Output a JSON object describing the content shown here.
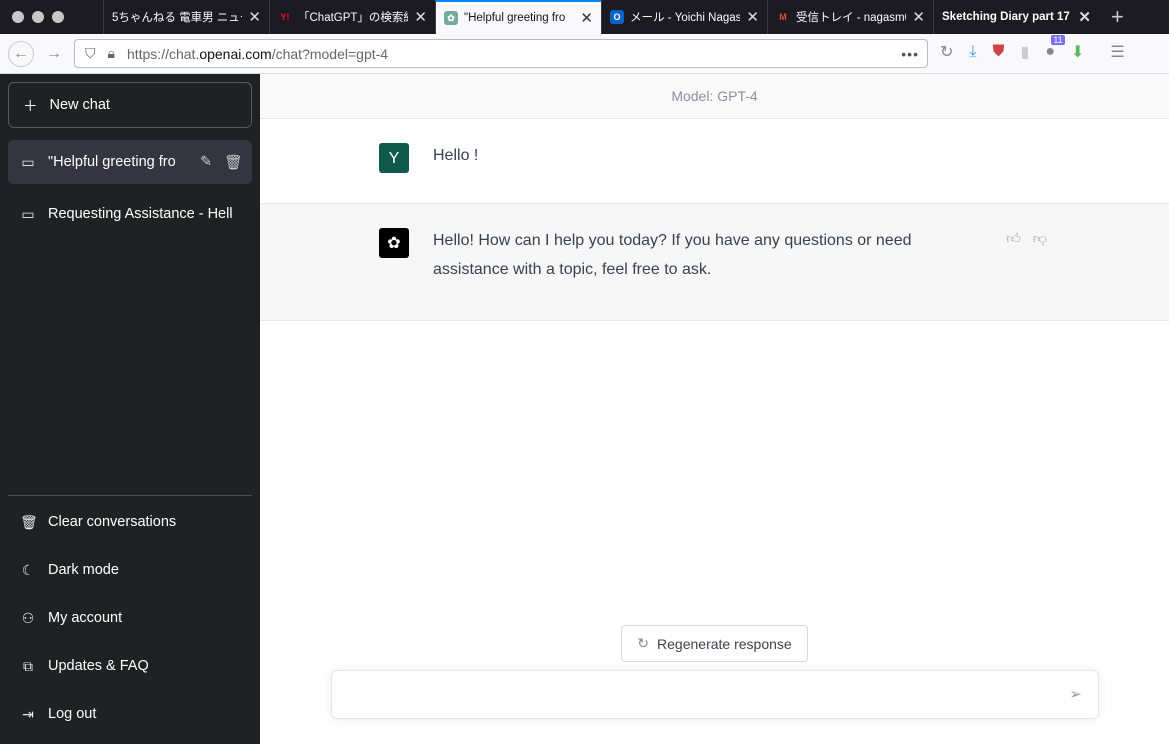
{
  "browser": {
    "tabs": [
      {
        "label": "5ちゃんねる 電車男 ニュー",
        "favicon": ""
      },
      {
        "label": "「ChatGPT」の検索結果",
        "favicon": "Y!"
      },
      {
        "label": "\"Helpful greeting fro",
        "favicon": "chatgpt",
        "active": true
      },
      {
        "label": "メール - Yoichi Nagas",
        "favicon": "O"
      },
      {
        "label": "受信トレイ - nagasm0",
        "favicon": "M"
      },
      {
        "label": "Sketching Diary part 17",
        "favicon": ""
      }
    ],
    "url_prefix": "https://chat.",
    "url_domain": "openai.com",
    "url_suffix": "/chat?model=gpt-4",
    "badge_count": "11"
  },
  "sidebar": {
    "new_chat": "New chat",
    "conversations": [
      "\"Helpful greeting fro",
      "Requesting Assistance - Hell"
    ],
    "items": [
      "Clear conversations",
      "Dark mode",
      "My account",
      "Updates & FAQ",
      "Log out"
    ]
  },
  "main": {
    "model_label": "Model: GPT-4",
    "user_initial": "Y",
    "user_message": "Hello !",
    "assistant_message": "Hello! How can I help you today? If you have any questions or need assistance with a topic, feel free to ask.",
    "regenerate": "Regenerate response",
    "input_placeholder": ""
  },
  "colors": {
    "user_avatar": "#0f5a4a",
    "sidebar": "#202123",
    "accent": "#0a84ff"
  }
}
